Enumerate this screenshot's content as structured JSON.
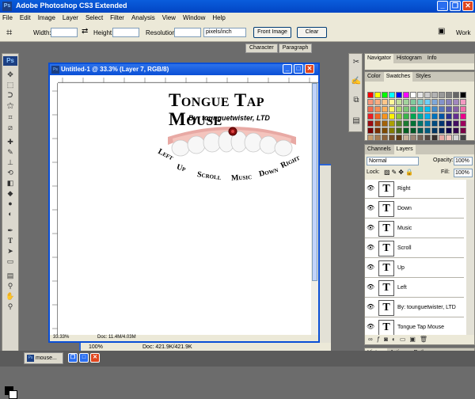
{
  "app": {
    "title": "Adobe Photoshop CS3 Extended",
    "icon": "Ps"
  },
  "menu": [
    "File",
    "Edit",
    "Image",
    "Layer",
    "Select",
    "Filter",
    "Analysis",
    "View",
    "Window",
    "Help"
  ],
  "options": {
    "width_label": "Width:",
    "height_label": "Height:",
    "resolution_label": "Resolution:",
    "units": "pixels/inch",
    "front_image": "Front Image",
    "clear": "Clear",
    "workspace": "Work"
  },
  "char_tabs": [
    "Character",
    "Paragraph"
  ],
  "document": {
    "title": "Untitled-1 @ 33.3% (Layer 7, RGB/8)",
    "zoom": "33.33%",
    "doc_info": "Doc: 11.4M/4.03M",
    "heading": "Tongue Tap Mouse",
    "byline": "By: tounguetwister, LTD",
    "labels": [
      "Left",
      "Up",
      "Scroll",
      "Music",
      "Down",
      "Right"
    ]
  },
  "doc2": {
    "zoom": "100%",
    "doc_info": "Doc: 421.9K/421.9K"
  },
  "nav_tabs": [
    "Navigator",
    "Histogram",
    "Info"
  ],
  "swatch_tabs": [
    "Color",
    "Swatches",
    "Styles"
  ],
  "layers": {
    "tabs": [
      "Channels",
      "Layers"
    ],
    "blend": "Normal",
    "opacity_label": "Opacity:",
    "opacity": "100%",
    "lock_label": "Lock:",
    "fill_label": "Fill:",
    "fill": "100%",
    "rows": [
      "Right",
      "Down",
      "Music",
      "Scroll",
      "Up",
      "Left",
      "By: tounguetwister, LTD",
      "Tongue Tap Mouse"
    ]
  },
  "history_tabs": [
    "History",
    "Actions",
    "Paths"
  ],
  "taskbar": {
    "item": "mouse..."
  },
  "colors": {
    "titlebar": "#0a5ddc",
    "panel": "#ece9d8",
    "workspace": "#6c6c6c"
  }
}
